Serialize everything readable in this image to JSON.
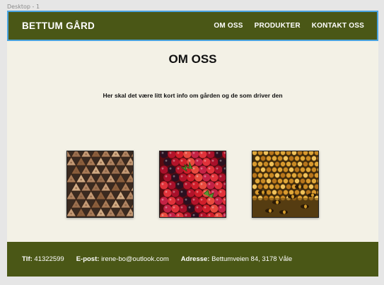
{
  "frame": {
    "label": "Desktop - 1"
  },
  "header": {
    "brand": "BETTUM GÅRD",
    "nav": [
      "OM OSS",
      "PRODUKTER",
      "KONTAKT OSS"
    ]
  },
  "main": {
    "title": "OM OSS",
    "intro": "Her skal det være litt kort info om gården og de som driver den"
  },
  "gallery": [
    {
      "subject": "firewood-photo"
    },
    {
      "subject": "berries-photo"
    },
    {
      "subject": "honeycomb-bees-photo"
    }
  ],
  "footer": {
    "phone_label": "Tlf:",
    "phone": "41322599",
    "email_label": "E-post:",
    "email": "irene-bo@outlook.com",
    "address_label": "Adresse:",
    "address": "Bettumveien 84, 3178 Våle"
  },
  "colors": {
    "brand_green": "#4a5716",
    "page_bg": "#f3f1e6",
    "selection_blue": "#4aa3df"
  }
}
